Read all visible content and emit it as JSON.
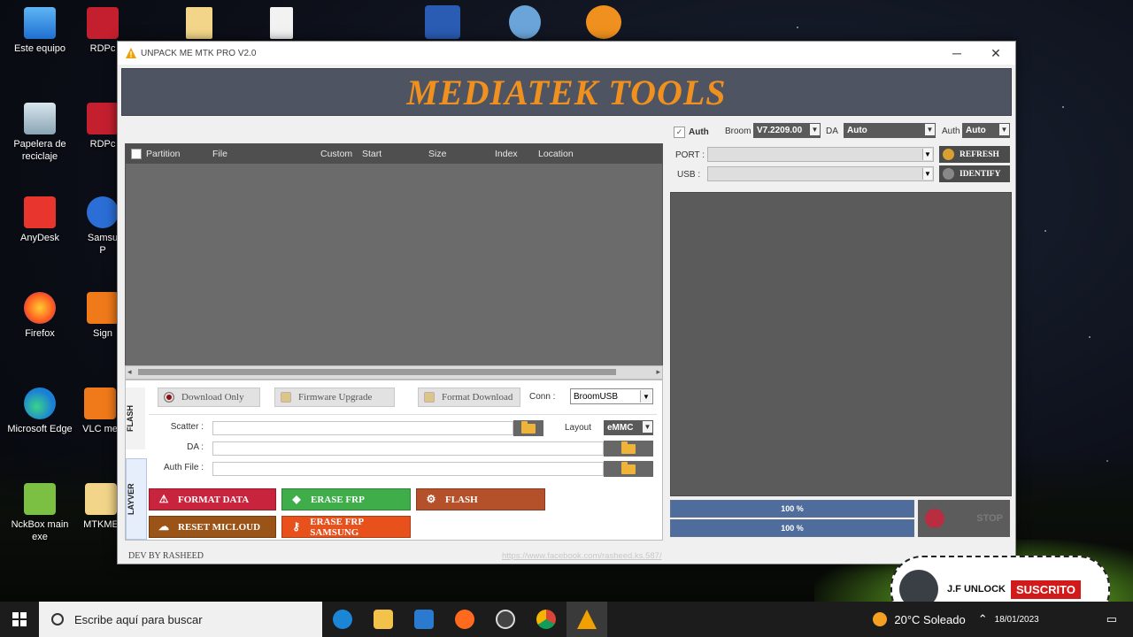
{
  "desktop": {
    "icons": [
      {
        "label": "Este equipo"
      },
      {
        "label": "RDPc"
      },
      {
        "label": "Papelera de reciclaje"
      },
      {
        "label": "RDPc"
      },
      {
        "label": "AnyDesk"
      },
      {
        "label": "Samsu P"
      },
      {
        "label": "Firefox"
      },
      {
        "label": "Sign"
      },
      {
        "label": "Microsoft Edge"
      },
      {
        "label": "VLC me"
      },
      {
        "label": "NckBox main exe"
      },
      {
        "label": "MTKME"
      }
    ]
  },
  "window": {
    "title": "UNPACK ME MTK PRO V2.0",
    "minimize_glyph": "─",
    "close_glyph": "✕",
    "banner": "MEDIATEK TOOLS"
  },
  "table": {
    "columns": [
      "Partition",
      "File",
      "Custom",
      "Start",
      "Size",
      "Index",
      "Location"
    ]
  },
  "left_tabs": {
    "flash": "FLASH",
    "other": "LAYVER"
  },
  "modes": {
    "download_only": "Download Only",
    "firmware_upgrade": "Firmware Upgrade",
    "format_download": "Format Download",
    "selected": "download_only"
  },
  "conn": {
    "label": "Conn :",
    "value": "BroomUSB"
  },
  "files": {
    "scatter_label": "Scatter :",
    "da_label": "DA :",
    "auth_label": "Auth File :",
    "layout_label": "Layout",
    "layout_value": "eMMC"
  },
  "actions": {
    "format_data": "FORMAT DATA",
    "erase_frp": "ERASE FRP",
    "flash": "FLASH",
    "reset_micloud": "RESET MICLOUD",
    "erase_frp_samsung": "ERASE FRP SAMSUNG"
  },
  "right": {
    "auth_check": "Auth",
    "broom_label": "Broom",
    "broom_value": "V7.2209.00",
    "da_label": "DA",
    "da_value": "Auto",
    "auth_label": "Auth",
    "auth_value": "Auto",
    "port_label": "PORT :",
    "usb_label": "USB :",
    "refresh": "REFRESH",
    "identify": "IDENTIFY",
    "progress1": {
      "text": "100 %",
      "value": 1.0
    },
    "progress2": {
      "text": "100 %",
      "value": 1.0
    },
    "stop": "STOP"
  },
  "footer": {
    "dev": "DEV BY RASHEED",
    "link": "https://www.facebook.com/rasheed.ks.587/"
  },
  "taskbar": {
    "search_placeholder": "Escribe aquí para buscar",
    "weather": "20°C  Soleado",
    "date": "18/01/2023"
  },
  "overlay": {
    "channel": "J.F UNLOCK",
    "subscribed": "SUSCRITO"
  },
  "colors": {
    "banner_text": "#f0901e",
    "format_data": "#c8243e",
    "erase_frp": "#3fae4a",
    "flash": "#b4502a",
    "reset_micloud": "#9a5418",
    "erase_frp_samsung": "#e8501c",
    "progress": "#4e6d9c"
  }
}
